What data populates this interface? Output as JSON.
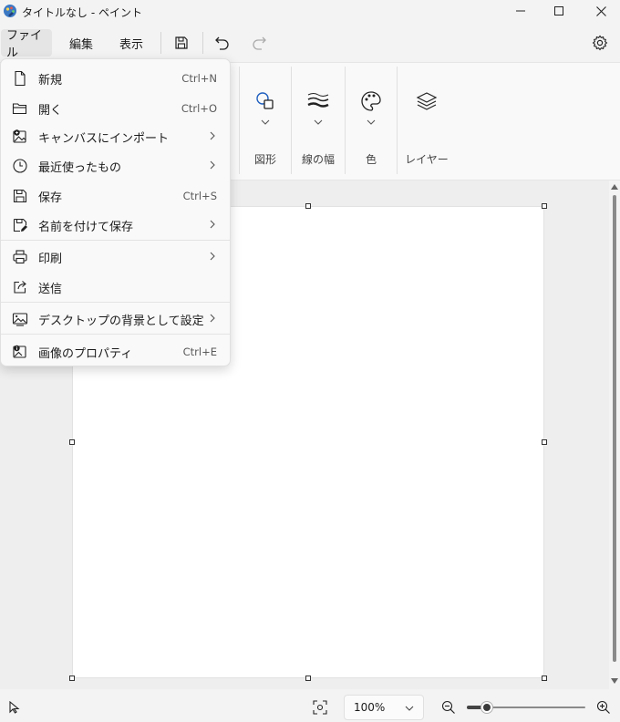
{
  "window": {
    "title": "タイトルなし - ペイント"
  },
  "menubar": {
    "file": "ファイル",
    "edit": "編集",
    "view": "表示"
  },
  "ribbon": {
    "shapes": "図形",
    "line_width": "線の幅",
    "color": "色",
    "layers": "レイヤー"
  },
  "file_menu": {
    "items": [
      {
        "label": "新規",
        "shortcut": "Ctrl+N",
        "icon": "new-file-icon"
      },
      {
        "label": "開く",
        "shortcut": "Ctrl+O",
        "icon": "open-folder-icon"
      },
      {
        "label": "キャンバスにインポート",
        "shortcut": "",
        "icon": "import-image-icon",
        "submenu": true
      },
      {
        "label": "最近使ったもの",
        "shortcut": "",
        "icon": "clock-icon",
        "submenu": true
      },
      {
        "label": "保存",
        "shortcut": "Ctrl+S",
        "icon": "save-icon"
      },
      {
        "label": "名前を付けて保存",
        "shortcut": "",
        "icon": "save-as-icon",
        "submenu": true
      },
      {
        "label": "印刷",
        "shortcut": "",
        "icon": "printer-icon",
        "submenu": true
      },
      {
        "label": "送信",
        "shortcut": "",
        "icon": "share-icon"
      },
      {
        "label": "デスクトップの背景として設定",
        "shortcut": "",
        "icon": "desktop-background-icon",
        "submenu": true
      },
      {
        "label": "画像のプロパティ",
        "shortcut": "Ctrl+E",
        "icon": "image-properties-icon"
      }
    ]
  },
  "statusbar": {
    "zoom": "100%",
    "zoom_level": 0.17
  }
}
